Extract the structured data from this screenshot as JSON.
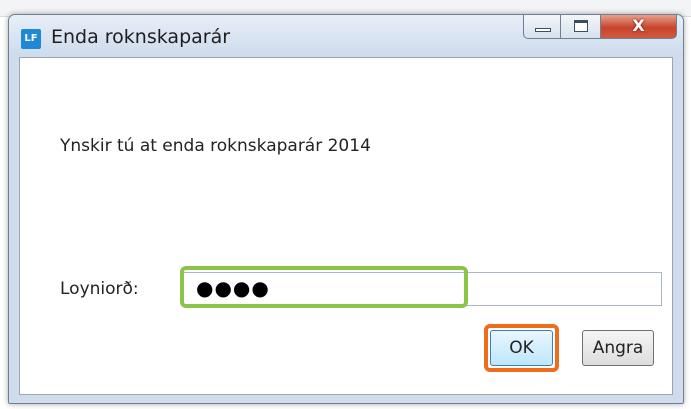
{
  "window": {
    "title": "Enda roknskaparár",
    "icon_text": "LF",
    "icon_name": "app-icon",
    "icon_color": "#1e8ad6"
  },
  "dialog": {
    "message": "Ynskir tú at enda roknskaparár 2014",
    "password_label": "Loyniorð:",
    "password_value": "●●●●",
    "ok_label": "OK",
    "cancel_label": "Angra"
  },
  "caption_buttons": {
    "minimize_icon": "minimize-icon",
    "maximize_icon": "maximize-icon",
    "close_icon": "close-icon",
    "close_glyph": "X"
  },
  "annotations": {
    "password_highlight_color": "#8cc44a",
    "ok_highlight_color": "#ef6c1b"
  }
}
